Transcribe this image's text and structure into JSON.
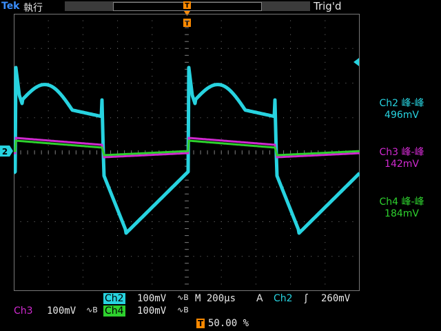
{
  "header": {
    "brand": "Tek",
    "mode": "執行",
    "trigger_status": "Trig'd",
    "trigger_marker": "T"
  },
  "measurements": [
    {
      "label": "Ch2 峰-峰",
      "value": "496mV",
      "color": "#27d3e0"
    },
    {
      "label": "Ch3 峰-峰",
      "value": "142mV",
      "color": "#d02ad0"
    },
    {
      "label": "Ch4 峰-峰",
      "value": "184mV",
      "color": "#2ed12e"
    }
  ],
  "channel_marker": "2",
  "status": {
    "ch2_name": "Ch2",
    "ch2_scale": "100mV",
    "ch2_bw": "∿B",
    "timebase": "M 200µs",
    "trig_mode": "A",
    "trig_src": "Ch2",
    "trig_slope": "ʃ",
    "trig_level": "260mV",
    "ch3_name": "Ch3",
    "ch3_scale": "100mV",
    "ch3_bw": "∿B",
    "ch4_name": "Ch4",
    "ch4_scale": "100mV",
    "ch4_bw": "∿B",
    "trig_pos_marker": "T",
    "trig_pos": "50.00 %"
  },
  "colors": {
    "ch2": "#27d3e0",
    "ch3": "#d02ad0",
    "ch4": "#2ed12e",
    "grid": "#7a7a7a",
    "trigger": "#ff8a00"
  }
}
